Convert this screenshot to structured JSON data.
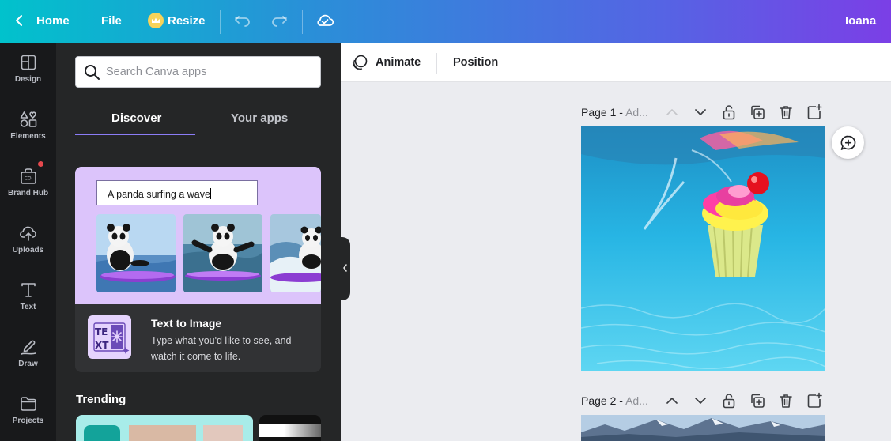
{
  "topbar": {
    "home_label": "Home",
    "file_label": "File",
    "resize_label": "Resize",
    "user_name": "Ioana"
  },
  "rail": {
    "items": [
      {
        "label": "Design",
        "icon": "layout-icon"
      },
      {
        "label": "Elements",
        "icon": "shapes-icon"
      },
      {
        "label": "Brand Hub",
        "icon": "brand-icon"
      },
      {
        "label": "Uploads",
        "icon": "cloud-upload-icon"
      },
      {
        "label": "Text",
        "icon": "text-icon"
      },
      {
        "label": "Draw",
        "icon": "pen-icon"
      },
      {
        "label": "Projects",
        "icon": "folder-icon"
      }
    ]
  },
  "panel": {
    "search_placeholder": "Search Canva apps",
    "tabs": [
      {
        "label": "Discover",
        "active": true
      },
      {
        "label": "Your apps",
        "active": false
      }
    ],
    "feature_card": {
      "prompt_text": "A panda surfing a wave",
      "title": "Text to Image",
      "description": "Type what you'd like to see, and watch it come to life."
    },
    "trending_label": "Trending"
  },
  "context_bar": {
    "animate_label": "Animate",
    "position_label": "Position"
  },
  "pages": [
    {
      "title": "Page 1 -",
      "subtitle": "Ad..."
    },
    {
      "title": "Page 2 -",
      "subtitle": "Ad..."
    }
  ],
  "colors": {
    "accent": "#8b7cf6",
    "topbar_start": "#01c2cc",
    "topbar_end": "#7b3fe6",
    "panel_bg": "#252627",
    "rail_bg": "#18191b"
  }
}
